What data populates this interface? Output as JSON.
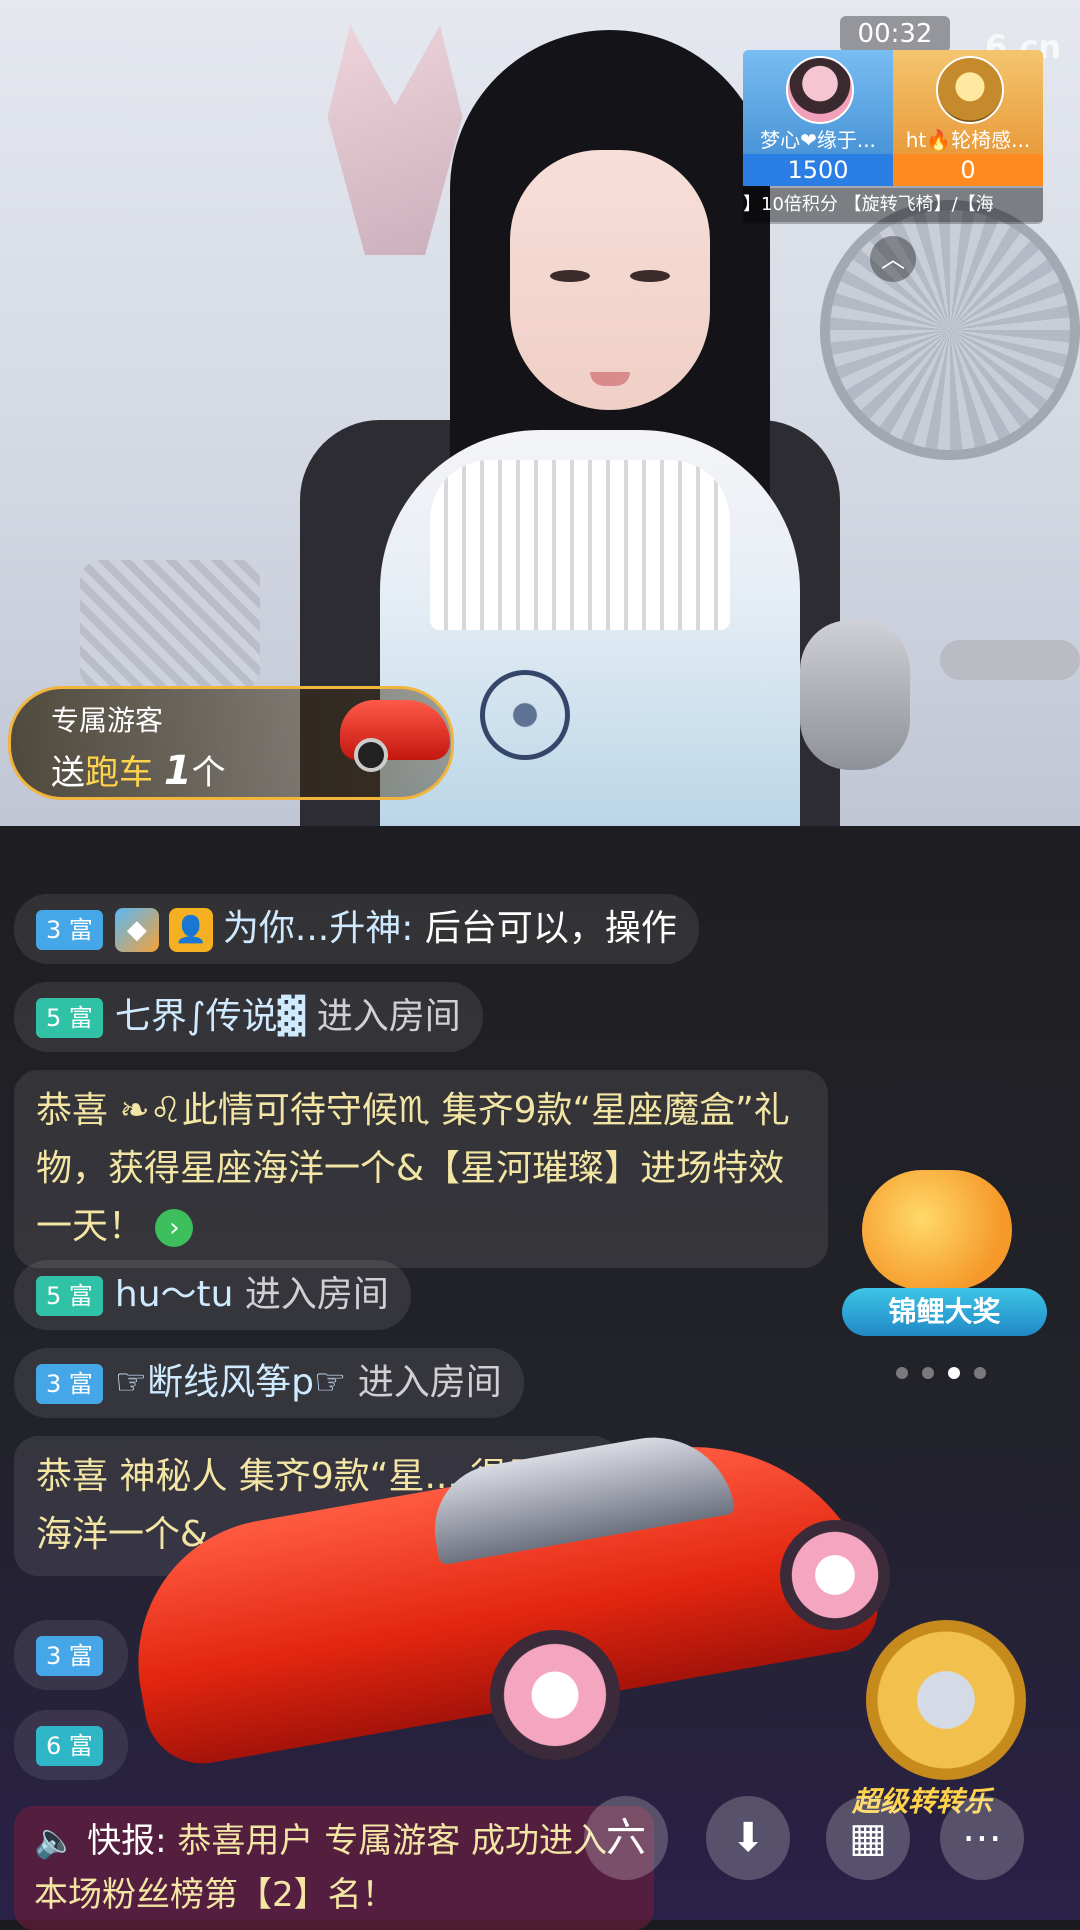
{
  "pk": {
    "timer": "00:32",
    "left": {
      "name": "梦心❤缘于...",
      "score": "1500"
    },
    "right": {
      "name": "ht🔥轮椅感...",
      "score": "0"
    },
    "ticker": "】10倍积分 【旋转飞椅】/【海",
    "logo": "6.cn"
  },
  "gift_banner": {
    "user": "专属游客",
    "action": "送",
    "gift": "跑车",
    "count": "1",
    "unit": "个"
  },
  "chat": [
    {
      "badge": "3 富",
      "name": "为你...升神:",
      "text": " 后台可以，操作"
    },
    {
      "badge": "5 富",
      "name": "七界∫传说▓",
      "text": " 进入房间"
    },
    {
      "text": "恭喜 ❧♌此情可待守候♏ 集齐9款“星座魔盒”礼物，获得星座海洋一个&【星河璀璨】进场特效一天！"
    },
    {
      "badge": "5 富",
      "name": "hu～tu",
      "text": " 进入房间"
    },
    {
      "badge": "3 富",
      "name": "☞断线风筝p☞",
      "text": " 进入房间"
    },
    {
      "text": "恭喜 神秘人 集齐9款“星... 得星座海洋一个&... 一天！"
    },
    {
      "badge": "3 富"
    },
    {
      "badge": "6 富"
    }
  ],
  "promo": {
    "carp_label": "锦鲤大奖",
    "spin_label": "超级转转乐"
  },
  "news": {
    "label": "快报:",
    "text": " 恭喜用户 专属游客 成功进入本场粉丝榜第【2】名！"
  },
  "buttons": {
    "six": "六",
    "download": "⬇",
    "grid": "▦",
    "more": "⋯"
  }
}
